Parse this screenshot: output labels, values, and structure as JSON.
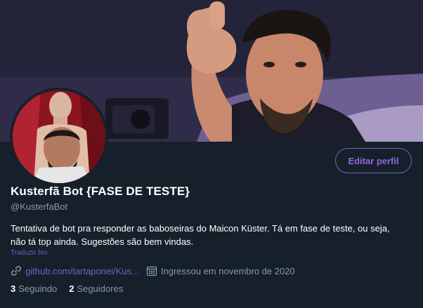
{
  "banner": {
    "description_icon": "header-photo"
  },
  "avatar": {
    "icon": "profile-photo"
  },
  "profile": {
    "edit_label": "Editar perfil",
    "name": "Kusterfã Bot {FASE DE TESTE}",
    "handle": "@KusterfaBot",
    "bio_line1": "Tentativa de bot pra responder as baboseiras do Maicon Küster. Tá em fase de teste, ou seja,",
    "bio_line2": "não tá top ainda. Sugestões são bem vindas.",
    "translate_label": "Traduzir bio",
    "website": "github.com/tartaponei/Kus...",
    "joined": "Ingressou em novembro de 2020"
  },
  "stats": {
    "following_count": "3",
    "following_label": "Seguindo",
    "followers_count": "2",
    "followers_label": "Seguidores"
  },
  "colors": {
    "background": "#15202b",
    "accent": "#8d6ad8",
    "secondary_text": "#8899a6"
  }
}
